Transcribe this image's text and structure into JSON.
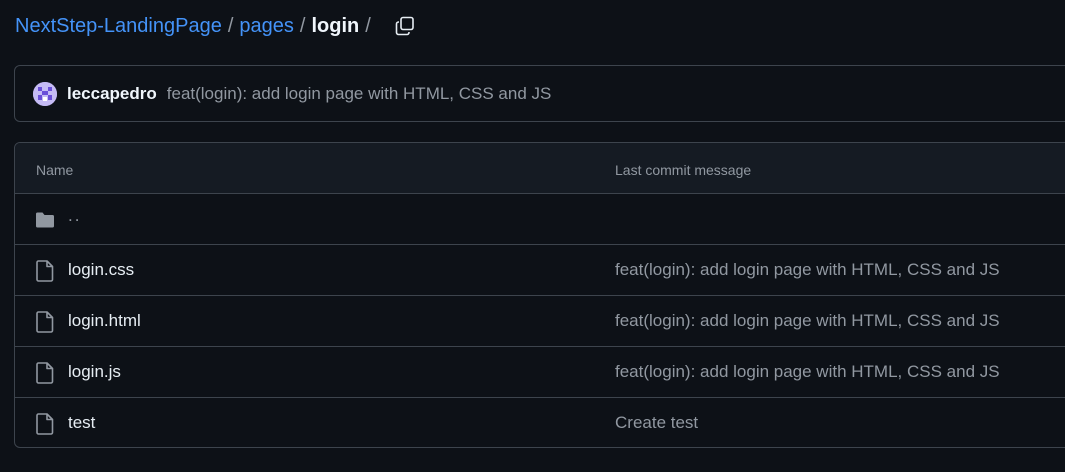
{
  "breadcrumb": {
    "repo": "NextStep-LandingPage",
    "folder": "pages",
    "current": "login",
    "sep": "/"
  },
  "commit": {
    "author": "leccapedro",
    "message": "feat(login): add login page with HTML, CSS and JS"
  },
  "table": {
    "headers": {
      "name": "Name",
      "message": "Last commit message"
    },
    "parent": "..",
    "rows": [
      {
        "name": "login.css",
        "message": "feat(login): add login page with HTML, CSS and JS"
      },
      {
        "name": "login.html",
        "message": "feat(login): add login page with HTML, CSS and JS"
      },
      {
        "name": "login.js",
        "message": "feat(login): add login page with HTML, CSS and JS"
      },
      {
        "name": "test",
        "message": "Create test"
      }
    ]
  },
  "colors": {
    "background": "#0d1117",
    "link": "#4493f8",
    "muted": "#9198a1",
    "border": "#3d444d"
  },
  "icons": [
    "copy-icon",
    "avatar",
    "folder-icon",
    "file-icon"
  ]
}
